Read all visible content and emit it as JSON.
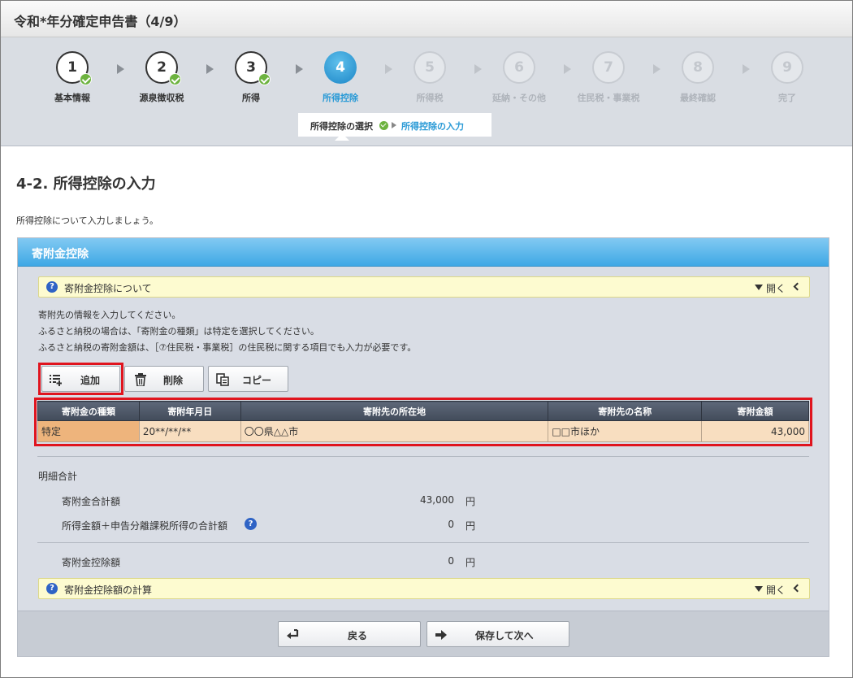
{
  "window": {
    "title": "令和*年分確定申告書（4/9）"
  },
  "steps": [
    {
      "num": "1",
      "label": "基本情報",
      "state": "done"
    },
    {
      "num": "2",
      "label": "源泉徴収税",
      "state": "done"
    },
    {
      "num": "3",
      "label": "所得",
      "state": "done"
    },
    {
      "num": "4",
      "label": "所得控除",
      "state": "current"
    },
    {
      "num": "5",
      "label": "所得税",
      "state": "future"
    },
    {
      "num": "6",
      "label": "延納・その他",
      "state": "future"
    },
    {
      "num": "7",
      "label": "住民税・事業税",
      "state": "future"
    },
    {
      "num": "8",
      "label": "最終確認",
      "state": "future"
    },
    {
      "num": "9",
      "label": "完了",
      "state": "future"
    }
  ],
  "substeps": {
    "first": "所得控除の選択",
    "second": "所得控除の入力"
  },
  "section": {
    "title": "4-2.  所得控除の入力",
    "description": "所得控除について入力しましょう。"
  },
  "panel": {
    "header": "寄附金控除",
    "about_bar": {
      "label": "寄附金控除について",
      "toggle": "開く"
    },
    "instructions": [
      "寄附先の情報を入力してください。",
      "ふるさと納税の場合は、「寄附金の種類」は特定を選択してください。",
      "ふるさと納税の寄附金額は、［⑦住民税・事業税］の住民税に関する項目でも入力が必要です。"
    ],
    "buttons": {
      "add": "追加",
      "delete": "削除",
      "copy": "コピー"
    },
    "table": {
      "headers": [
        "寄附金の種類",
        "寄附年月日",
        "寄附先の所在地",
        "寄附先の名称",
        "寄附金額"
      ],
      "rows": [
        [
          "特定",
          "20**/**/**",
          "〇〇県△△市",
          "□□市ほか",
          "43,000"
        ]
      ]
    },
    "summary": {
      "heading": "明細合計",
      "total_label": "寄附金合計額",
      "total_value": "43,000",
      "income_label": "所得金額＋申告分離課税所得の合計額",
      "income_value": "0",
      "deduction_label": "寄附金控除額",
      "deduction_value": "0",
      "currency": "円"
    },
    "calc_bar": {
      "label": "寄附金控除額の計算",
      "toggle": "開く"
    }
  },
  "footer": {
    "back": "戻る",
    "next": "保存して次へ"
  },
  "colors": {
    "accent": "#2a9ad6",
    "panel_header": "#3ea8e5",
    "highlight": "#e0141e",
    "done_check": "#6db33f"
  }
}
